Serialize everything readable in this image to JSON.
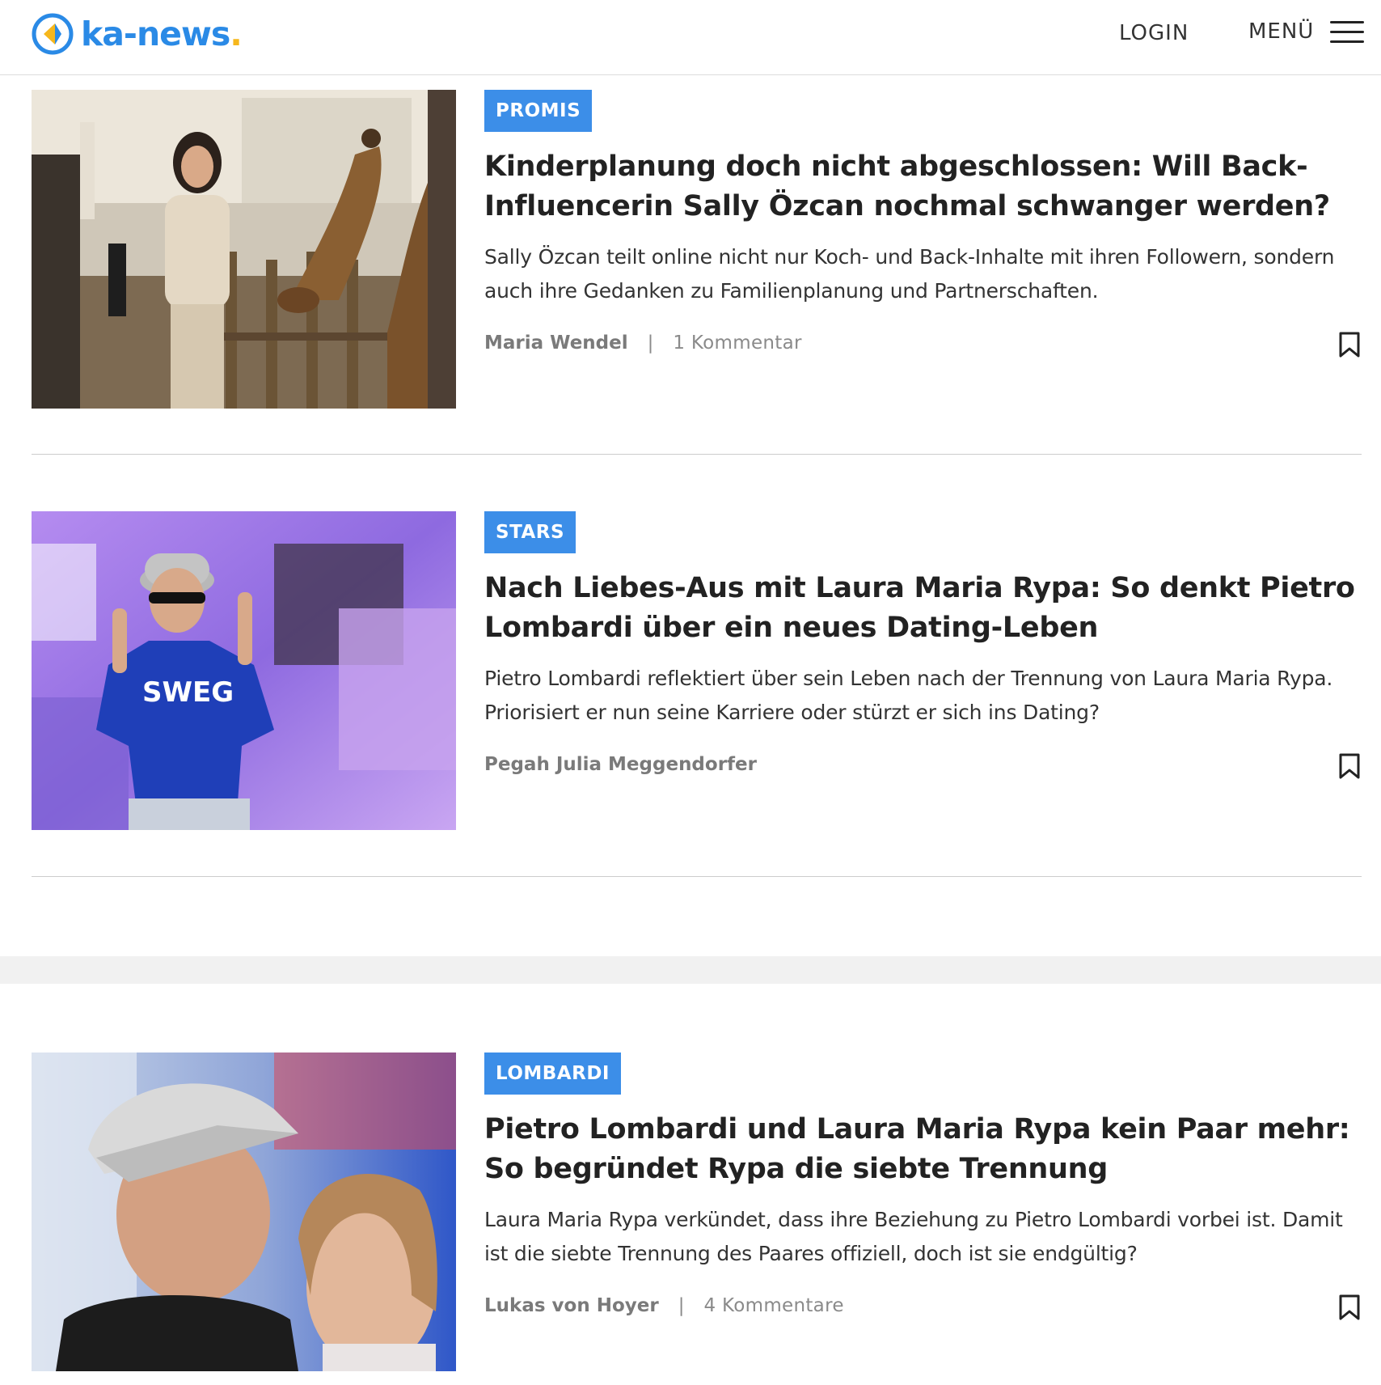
{
  "header": {
    "logo_text": "ka-news",
    "logo_dot": ".",
    "login_label": "LOGIN",
    "menu_label": "MENÜ"
  },
  "colors": {
    "brand_blue": "#2a8ae6",
    "brand_yellow": "#f6b71c",
    "tag_blue": "#3c8ee8"
  },
  "articles": [
    {
      "tag": "PROMIS",
      "title": "Kinderplanung doch nicht abgeschlossen: Will Back-Influencerin Sally Özcan nochmal schwanger werden?",
      "teaser": "Sally Özcan teilt online nicht nur Koch- und Back-Inhalte mit ihren Followern, sondern auch ihre Gedanken zu Familienplanung und Partnerschaften.",
      "author": "Maria Wendel",
      "separator": "|",
      "comments": "1 Kommentar"
    },
    {
      "tag": "STARS",
      "title": "Nach Liebes-Aus mit Laura Maria Rypa: So denkt Pietro Lombardi über ein neues Dating-Leben",
      "teaser": "Pietro Lombardi reflektiert über sein Leben nach der Trennung von Laura Maria Rypa. Priorisiert er nun seine Karriere oder stürzt er sich ins Dating?",
      "author": "Pegah Julia Meggendorfer"
    },
    {
      "tag": "LOMBARDI",
      "title": "Pietro Lombardi und Laura Maria Rypa kein Paar mehr: So begründet Rypa die siebte Trennung",
      "teaser": "Laura Maria Rypa verkündet, dass ihre Beziehung zu Pietro Lombardi vorbei ist. Damit ist die siebte Trennung des Paares offiziell, doch ist sie endgültig?",
      "author": "Lukas von Hoyer",
      "separator": "|",
      "comments": "4 Kommentare"
    }
  ]
}
